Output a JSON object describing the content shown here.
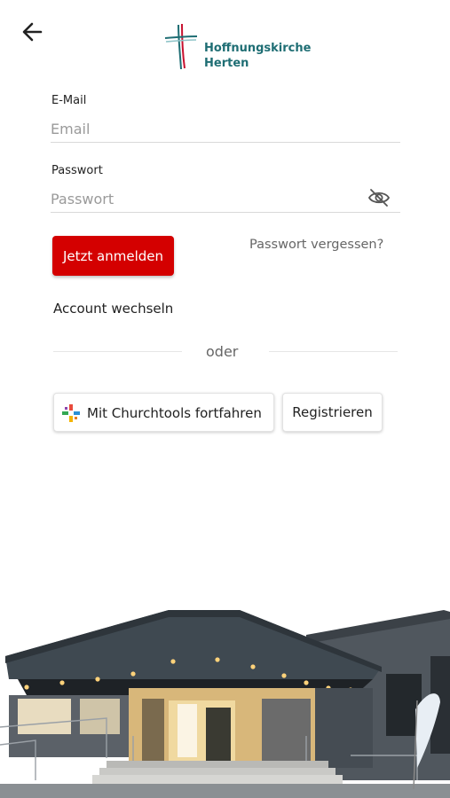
{
  "header": {
    "back_icon": "arrow-left-icon",
    "logo_line1": "Hoffnungskirche",
    "logo_line2": "Herten",
    "colors": {
      "logo_teal": "#1f6e74",
      "logo_red": "#c8102e"
    }
  },
  "form": {
    "email_label": "E-Mail",
    "email_placeholder": "Email",
    "email_value": "",
    "password_label": "Passwort",
    "password_placeholder": "Passwort",
    "password_value": "",
    "password_toggle_icon": "eye-off-icon"
  },
  "actions": {
    "login_label": "Jetzt anmelden",
    "forgot_label": "Passwort vergessen?",
    "switch_account_label": "Account wechseln",
    "divider_text": "oder",
    "churchtools_label": "Mit Churchtools fortfahren",
    "churchtools_icon": "churchtools-icon",
    "register_label": "Registrieren"
  },
  "colors": {
    "primary": "#d40000",
    "text": "#222222",
    "muted": "#666666"
  },
  "footer": {
    "image": "church-building-photo"
  }
}
